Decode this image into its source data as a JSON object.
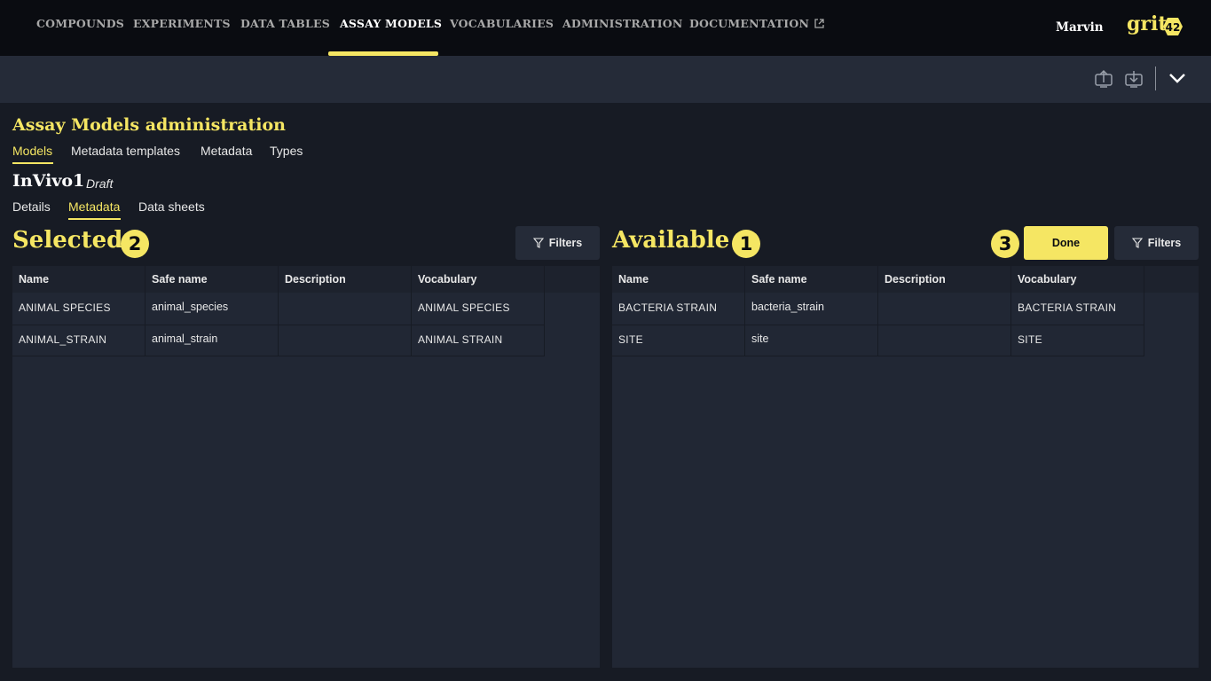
{
  "nav": {
    "items": [
      {
        "label": "COMPOUNDS"
      },
      {
        "label": "EXPERIMENTS"
      },
      {
        "label": "DATA TABLES"
      },
      {
        "label": "ASSAY MODELS"
      },
      {
        "label": "VOCABULARIES"
      },
      {
        "label": "ADMINISTRATION"
      },
      {
        "label": "DOCUMENTATION"
      }
    ],
    "active": "ASSAY MODELS",
    "user": "Marvin",
    "logo_text": "grit",
    "logo_badge": "42"
  },
  "toolbar": {
    "icons": [
      "upload-icon",
      "download-icon",
      "chevron-down-icon"
    ]
  },
  "page": {
    "title": "Assay Models administration",
    "tabs": [
      {
        "label": "Models"
      },
      {
        "label": "Metadata templates"
      },
      {
        "label": "Metadata"
      },
      {
        "label": "Types"
      }
    ],
    "active_tab": "Models"
  },
  "model": {
    "name": "InVivo1",
    "status": "Draft",
    "tabs": [
      {
        "label": "Details"
      },
      {
        "label": "Metadata"
      },
      {
        "label": "Data sheets"
      }
    ],
    "active_tab": "Metadata"
  },
  "selected": {
    "title": "Selected",
    "marker": "2",
    "filters_label": "Filters",
    "columns": [
      "Name",
      "Safe name",
      "Description",
      "Vocabulary"
    ],
    "rows": [
      {
        "name": "ANIMAL SPECIES",
        "safe_name": "animal_species",
        "description": "",
        "vocabulary": "ANIMAL SPECIES"
      },
      {
        "name": "ANIMAL_STRAIN",
        "safe_name": "animal_strain",
        "description": "",
        "vocabulary": "ANIMAL STRAIN"
      }
    ]
  },
  "available": {
    "title": "Available",
    "marker": "1",
    "done_marker": "3",
    "done_label": "Done",
    "filters_label": "Filters",
    "columns": [
      "Name",
      "Safe name",
      "Description",
      "Vocabulary"
    ],
    "rows": [
      {
        "name": "BACTERIA STRAIN",
        "safe_name": "bacteria_strain",
        "description": "",
        "vocabulary": "BACTERIA STRAIN"
      },
      {
        "name": "SITE",
        "safe_name": "site",
        "description": "",
        "vocabulary": "SITE"
      }
    ]
  },
  "colors": {
    "accent": "#f5e663",
    "nav_bg": "#0a0c11",
    "toolbar_bg": "#252b38",
    "panel_bg": "#212734"
  }
}
